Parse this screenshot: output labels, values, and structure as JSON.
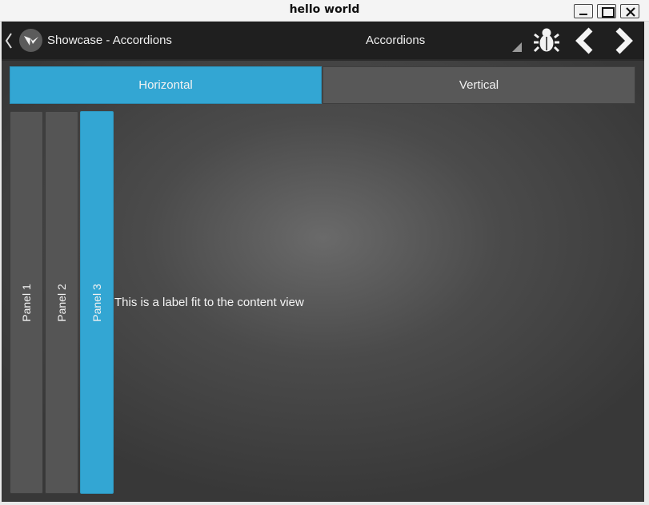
{
  "window": {
    "title": "hello world",
    "controls": [
      "minimize",
      "maximize",
      "close"
    ]
  },
  "actionbar": {
    "back_icon": "chevron-left-icon",
    "logo_icon": "kivy-logo-icon",
    "title": "Showcase - Accordions",
    "spinner_value": "Accordions",
    "buttons": [
      "bug-icon",
      "prev-arrow-icon",
      "next-arrow-icon"
    ]
  },
  "tabs": [
    {
      "label": "Horizontal",
      "selected": true
    },
    {
      "label": "Vertical",
      "selected": false
    }
  ],
  "accordion": {
    "panels": [
      {
        "label": "Panel 1",
        "collapsed": true
      },
      {
        "label": "Panel 2",
        "collapsed": true
      },
      {
        "label": "Panel 3",
        "collapsed": false
      }
    ],
    "content_text": "This is a label fit to the content view"
  },
  "colors": {
    "accent": "#33a6d3",
    "actionbar_bg": "#1f1f1f",
    "panel_bg": "#555555",
    "background": "#4b4b4b"
  }
}
